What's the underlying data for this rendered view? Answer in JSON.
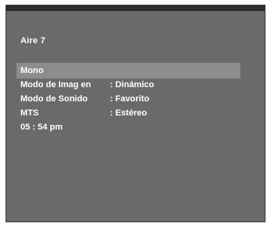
{
  "osd": {
    "channel": "Aire  7",
    "audio_mode": "Mono",
    "rows": [
      {
        "label": "Modo de Imag en",
        "value": ": Dinámico"
      },
      {
        "label": "Modo de Sonido",
        "value": ": Favorito"
      },
      {
        "label": "MTS",
        "value": ": Estéreo"
      }
    ],
    "time": "05 : 54 pm"
  },
  "colors": {
    "screen_bg": "#6a6a6a",
    "highlight_bar": "#8d8d8d",
    "top_strip": "#2c2c2c",
    "text": "#ffffff"
  }
}
